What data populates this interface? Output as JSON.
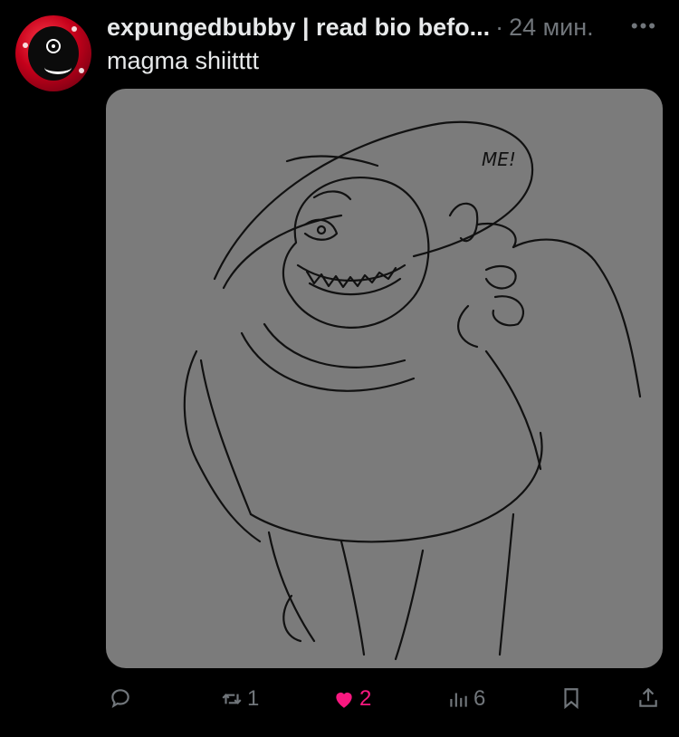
{
  "tweet": {
    "author": "expungedbubby | read bio befo...",
    "separator": "·",
    "time": "24 мин.",
    "text": "magma shiitttt",
    "media": {
      "annotation": "ME!"
    }
  },
  "actions": {
    "replies": "",
    "retweets": "1",
    "likes": "2",
    "views": "6"
  },
  "colors": {
    "background": "#000000",
    "muted": "#71767b",
    "like_active": "#f91880",
    "media_bg": "#7b7b7b"
  },
  "icons": [
    "more-icon",
    "reply-icon",
    "retweet-icon",
    "like-icon",
    "views-icon",
    "bookmark-icon",
    "share-icon"
  ]
}
